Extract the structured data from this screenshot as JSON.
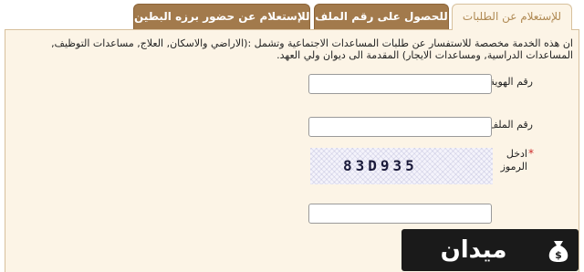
{
  "tabs": [
    {
      "label": "للإستعلام عن الطلبات",
      "active": true
    },
    {
      "label": "للحصول على رقم الملف",
      "active": false
    },
    {
      "label": "للإستعلام عن حضور برزه البطين",
      "active": false
    }
  ],
  "description": "ان هذه الخدمة مخصصة للاستفسار عن طلبات المساعدات الاجتماعية وتشمل :(الاراضي والاسكان, العلاج, مساعدات التوظيف, المساعدات الدراسية, ومساعدات الايجار) المقدمة الى ديوان ولي العهد.",
  "form": {
    "required_mark": "*",
    "id_label": "رقم الهوية",
    "id_value": "",
    "file_label": "رقم الملف",
    "file_value": "",
    "code_label": "ادخل الرموز",
    "code_value": "",
    "captcha_text": "83D935"
  },
  "watermark": {
    "text": "ميدان المال",
    "icon": "money-bag-icon"
  },
  "colors": {
    "active_tab_bg": "#fcf4e6",
    "active_tab_text": "#b08a54",
    "inactive_tab_bg": "#a27a4c",
    "required_star": "#cc2a2a",
    "watermark_bg": "#1a1a1a"
  }
}
